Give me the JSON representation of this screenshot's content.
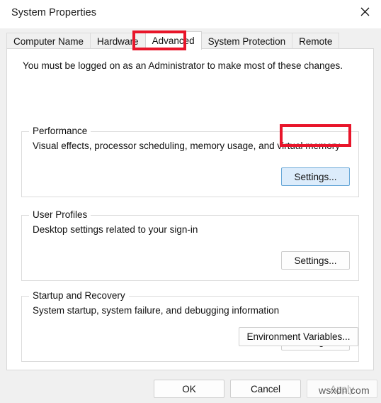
{
  "window": {
    "title": "System Properties",
    "close_icon": "close-icon"
  },
  "tabs": [
    {
      "label": "Computer Name",
      "selected": false
    },
    {
      "label": "Hardware",
      "selected": false
    },
    {
      "label": "Advanced",
      "selected": true
    },
    {
      "label": "System Protection",
      "selected": false
    },
    {
      "label": "Remote",
      "selected": false
    }
  ],
  "page": {
    "admin_note": "You must be logged on as an Administrator to make most of these changes.",
    "groups": [
      {
        "label": "Performance",
        "description": "Visual effects, processor scheduling, memory usage, and virtual memory",
        "button_label": "Settings...",
        "button_state": "hover"
      },
      {
        "label": "User Profiles",
        "description": "Desktop settings related to your sign-in",
        "button_label": "Settings...",
        "button_state": "normal"
      },
      {
        "label": "Startup and Recovery",
        "description": "System startup, system failure, and debugging information",
        "button_label": "Settings...",
        "button_state": "normal"
      }
    ],
    "environment_variables_label": "Environment Variables..."
  },
  "footer": {
    "ok_label": "OK",
    "cancel_label": "Cancel",
    "apply_label": "Apply",
    "apply_enabled": false
  },
  "annotations": {
    "color": "#E8152A",
    "targets": [
      "advanced-tab",
      "performance-settings-button"
    ]
  },
  "watermark": {
    "text": "wsxdn.com"
  }
}
